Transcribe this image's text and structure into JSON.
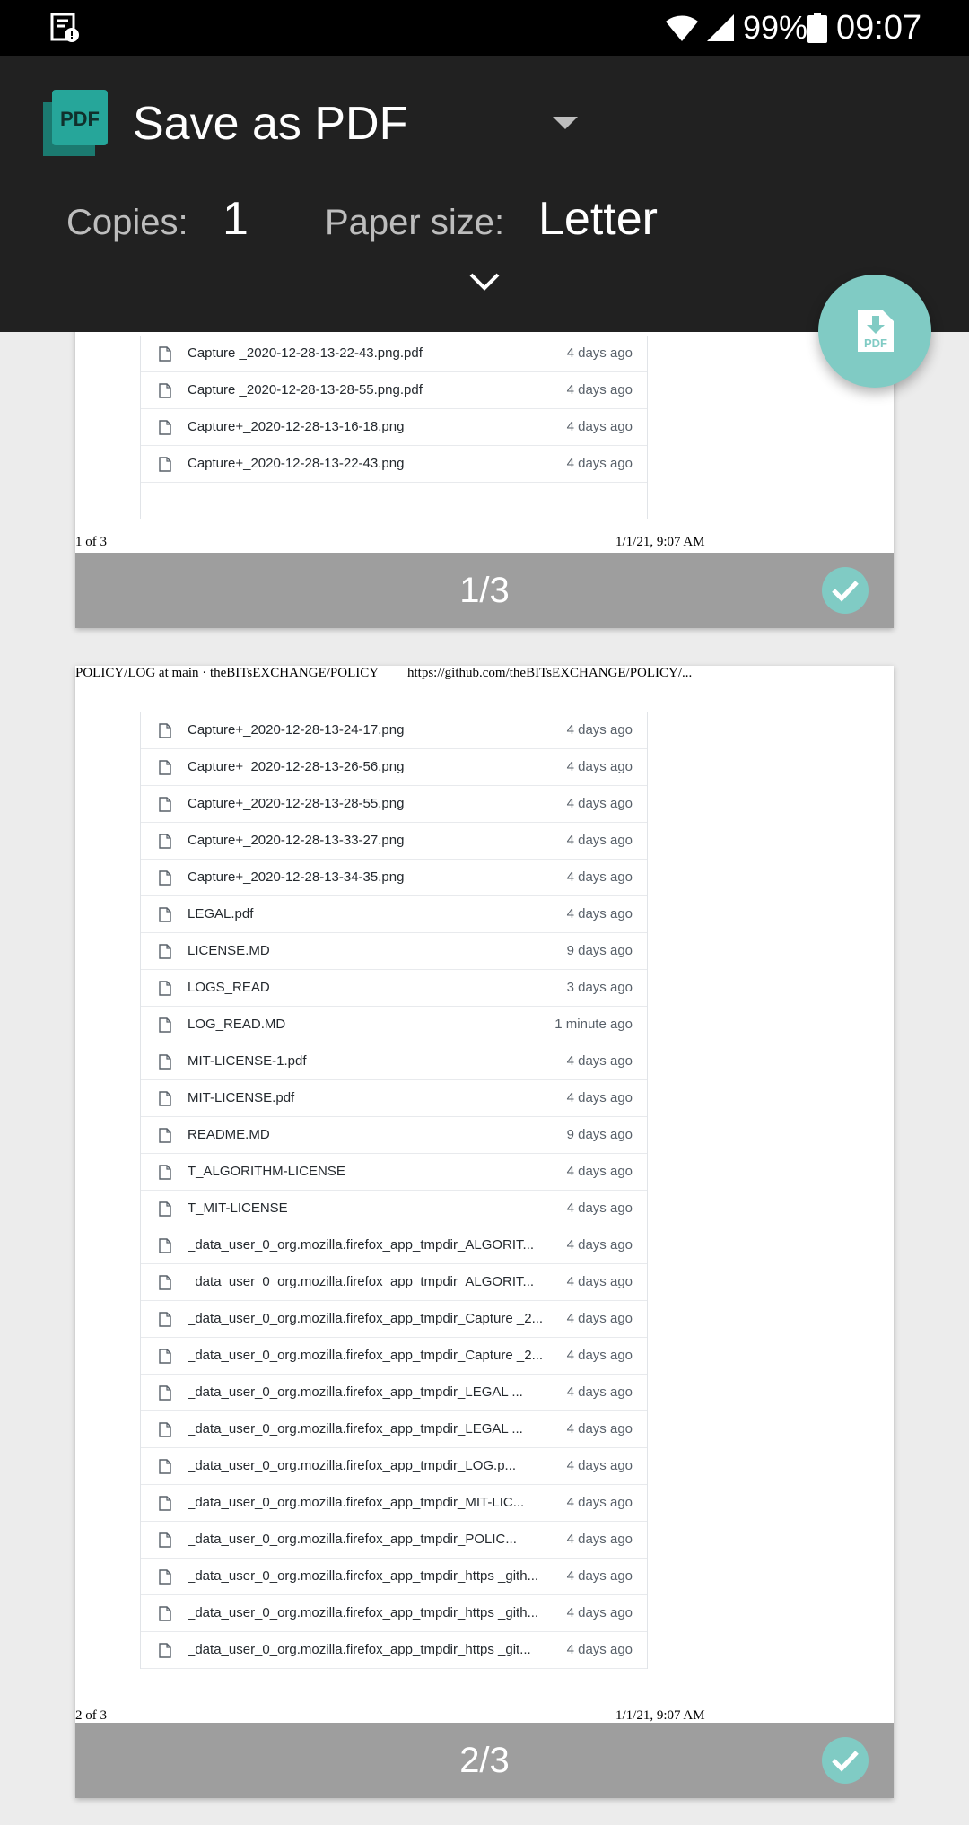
{
  "status_bar": {
    "battery_percent": "99%",
    "time": "09:07",
    "icons": [
      "notification-icon",
      "wifi-icon",
      "signal-icon",
      "battery-icon"
    ]
  },
  "print_header": {
    "printer_name": "Save as PDF",
    "copies_label": "Copies:",
    "copies_value": "1",
    "paper_size_label": "Paper size:",
    "paper_size_value": "Letter",
    "logo_text": "PDF"
  },
  "fab": {
    "label": "PDF",
    "icon": "download-pdf-icon",
    "color": "#80cbc4"
  },
  "pages": [
    {
      "page_label": "1/3",
      "footer_left": "1 of 3",
      "footer_right": "1/1/21, 9:07 AM",
      "files": [
        {
          "name": "Capture _2020-12-28-13-22-43.png.pdf",
          "age": "4 days ago"
        },
        {
          "name": "Capture _2020-12-28-13-28-55.png.pdf",
          "age": "4 days ago"
        },
        {
          "name": "Capture+_2020-12-28-13-16-18.png",
          "age": "4 days ago"
        },
        {
          "name": "Capture+_2020-12-28-13-22-43.png",
          "age": "4 days ago"
        }
      ]
    },
    {
      "page_label": "2/3",
      "header_left": "POLICY/LOG at main · theBITsEXCHANGE/POLICY",
      "header_right": "https://github.com/theBITsEXCHANGE/POLICY/...",
      "footer_left": "2 of 3",
      "footer_right": "1/1/21, 9:07 AM",
      "files": [
        {
          "name": "Capture+_2020-12-28-13-24-17.png",
          "age": "4 days ago"
        },
        {
          "name": "Capture+_2020-12-28-13-26-56.png",
          "age": "4 days ago"
        },
        {
          "name": "Capture+_2020-12-28-13-28-55.png",
          "age": "4 days ago"
        },
        {
          "name": "Capture+_2020-12-28-13-33-27.png",
          "age": "4 days ago"
        },
        {
          "name": "Capture+_2020-12-28-13-34-35.png",
          "age": "4 days ago"
        },
        {
          "name": "LEGAL.pdf",
          "age": "4 days ago"
        },
        {
          "name": "LICENSE.MD",
          "age": "9 days ago"
        },
        {
          "name": "LOGS_READ",
          "age": "3 days ago"
        },
        {
          "name": "LOG_READ.MD",
          "age": "1 minute ago"
        },
        {
          "name": "MIT-LICENSE-1.pdf",
          "age": "4 days ago"
        },
        {
          "name": "MIT-LICENSE.pdf",
          "age": "4 days ago"
        },
        {
          "name": "README.MD",
          "age": "9 days ago"
        },
        {
          "name": "T_ALGORITHM-LICENSE",
          "age": "4 days ago"
        },
        {
          "name": "T_MIT-LICENSE",
          "age": "4 days ago"
        },
        {
          "name": "_data_user_0_org.mozilla.firefox_app_tmpdir_ALGORIT...",
          "age": "4 days ago"
        },
        {
          "name": "_data_user_0_org.mozilla.firefox_app_tmpdir_ALGORIT...",
          "age": "4 days ago"
        },
        {
          "name": "_data_user_0_org.mozilla.firefox_app_tmpdir_Capture _2...",
          "age": "4 days ago"
        },
        {
          "name": "_data_user_0_org.mozilla.firefox_app_tmpdir_Capture _2...",
          "age": "4 days ago"
        },
        {
          "name": "_data_user_0_org.mozilla.firefox_app_tmpdir_LEGAL ...",
          "age": "4 days ago"
        },
        {
          "name": "_data_user_0_org.mozilla.firefox_app_tmpdir_LEGAL ...",
          "age": "4 days ago"
        },
        {
          "name": "_data_user_0_org.mozilla.firefox_app_tmpdir_LOG.p...",
          "age": "4 days ago"
        },
        {
          "name": "_data_user_0_org.mozilla.firefox_app_tmpdir_MIT-LIC...",
          "age": "4 days ago"
        },
        {
          "name": "_data_user_0_org.mozilla.firefox_app_tmpdir_POLIC...",
          "age": "4 days ago"
        },
        {
          "name": "_data_user_0_org.mozilla.firefox_app_tmpdir_https _gith...",
          "age": "4 days ago"
        },
        {
          "name": "_data_user_0_org.mozilla.firefox_app_tmpdir_https _gith...",
          "age": "4 days ago"
        },
        {
          "name": "_data_user_0_org.mozilla.firefox_app_tmpdir_https _git...",
          "age": "4 days ago"
        }
      ]
    }
  ]
}
